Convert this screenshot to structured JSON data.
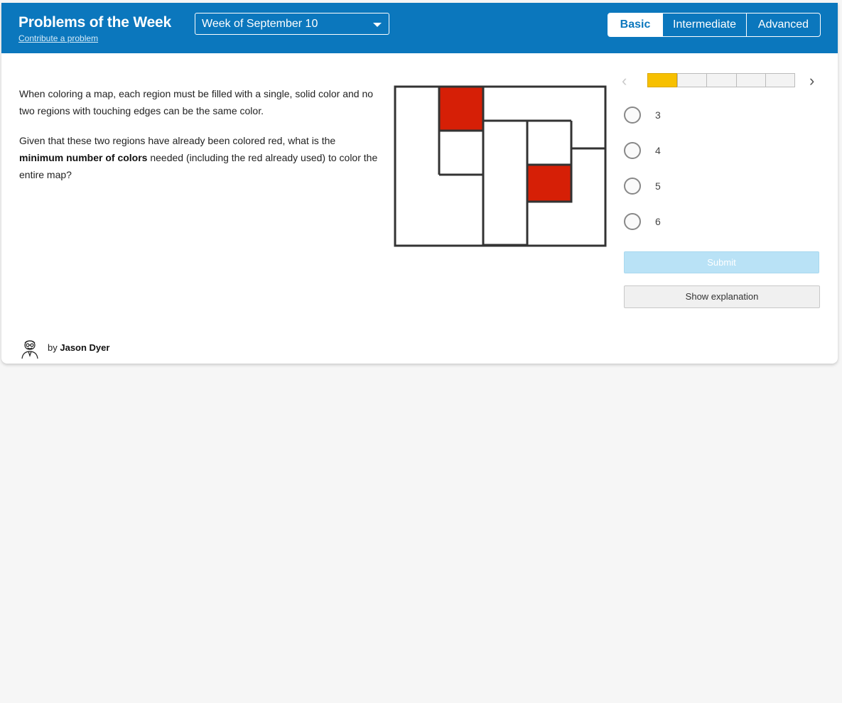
{
  "header": {
    "title": "Problems of the Week",
    "contribute_link": "Contribute a problem",
    "week_select": "Week of September 10",
    "levels": [
      {
        "label": "Basic",
        "active": true
      },
      {
        "label": "Intermediate",
        "active": false
      },
      {
        "label": "Advanced",
        "active": false
      }
    ]
  },
  "problem": {
    "paragraph1": "When coloring a map, each region must be filled with a single, solid color and no two regions with touching edges can be the same color.",
    "paragraph2_start": "Given that these two regions have already been colored red, what is the ",
    "paragraph2_bold": "minimum number of colors",
    "paragraph2_end": " needed (including the red already used) to color the entire map?"
  },
  "map_colors": {
    "filled": "#d61f06",
    "stroke": "#333333",
    "empty": "#ffffff"
  },
  "progress": {
    "total_segments": 5,
    "current_segment": 1
  },
  "answers": [
    "3",
    "4",
    "5",
    "6"
  ],
  "buttons": {
    "submit": "Submit",
    "show_explanation": "Show explanation"
  },
  "author": {
    "prefix": "by",
    "name": "Jason Dyer"
  },
  "icons": {
    "prev": "chevron-left-icon",
    "next": "chevron-right-icon",
    "dropdown": "caret-down-icon"
  },
  "colors": {
    "header": "#0b77bd",
    "progress_current": "#f7c000",
    "submit_disabled": "#b9e2f6"
  }
}
